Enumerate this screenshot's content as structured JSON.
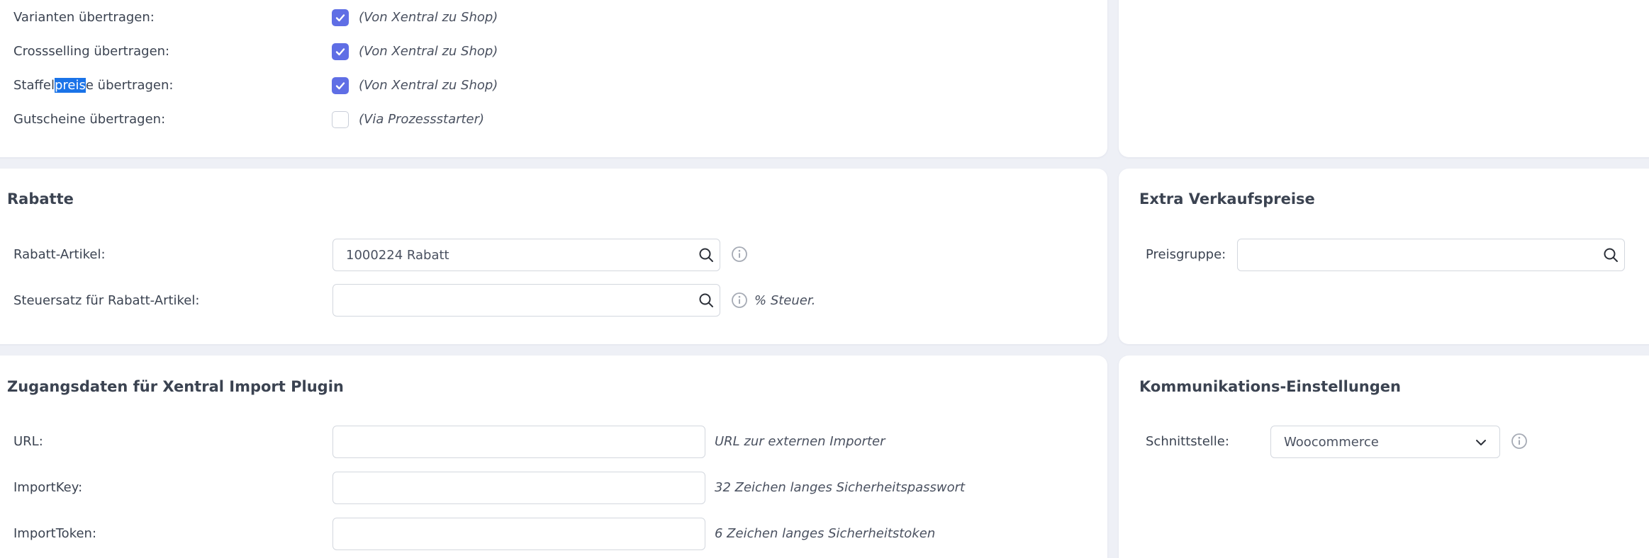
{
  "transfer": {
    "rows": [
      {
        "label_pre": "Varianten übertragen:",
        "label_hl": "",
        "label_post": "",
        "checked": true,
        "hint": "(Von Xentral zu Shop)"
      },
      {
        "label_pre": "Crossselling übertragen:",
        "label_hl": "",
        "label_post": "",
        "checked": true,
        "hint": "(Von Xentral zu Shop)"
      },
      {
        "label_pre": "Staffel",
        "label_hl": "preis",
        "label_post": "e übertragen:",
        "checked": true,
        "hint": "(Von Xentral zu Shop)"
      },
      {
        "label_pre": "Gutscheine übertragen:",
        "label_hl": "",
        "label_post": "",
        "checked": false,
        "hint": "(Via Prozessstarter)"
      }
    ]
  },
  "rabatte": {
    "title": "Rabatte",
    "rabatt_artikel_label": "Rabatt-Artikel:",
    "rabatt_artikel_value": "1000224 Rabatt",
    "steuersatz_label": "Steuersatz für Rabatt-Artikel:",
    "steuersatz_value": "",
    "steuersatz_hint": "% Steuer."
  },
  "extra": {
    "title": "Extra Verkaufspreise",
    "preisgruppe_label": "Preisgruppe:",
    "preisgruppe_value": ""
  },
  "zugang": {
    "title": "Zugangsdaten für Xentral Import Plugin",
    "url_label": "URL:",
    "url_value": "",
    "url_hint": "URL zur externen Importer",
    "key_label": "ImportKey:",
    "key_value": "",
    "key_hint": "32 Zeichen langes Sicherheitspasswort",
    "token_label": "ImportToken:",
    "token_value": "",
    "token_hint": "6 Zeichen langes Sicherheitstoken"
  },
  "komm": {
    "title": "Kommunikations-Einstellungen",
    "schnittstelle_label": "Schnittstelle:",
    "schnittstelle_value": "Woocommerce"
  },
  "colors": {
    "checkbox_checked": "#5f6ee5",
    "selection_highlight": "#1a73e8",
    "background": "#eef0f6"
  }
}
